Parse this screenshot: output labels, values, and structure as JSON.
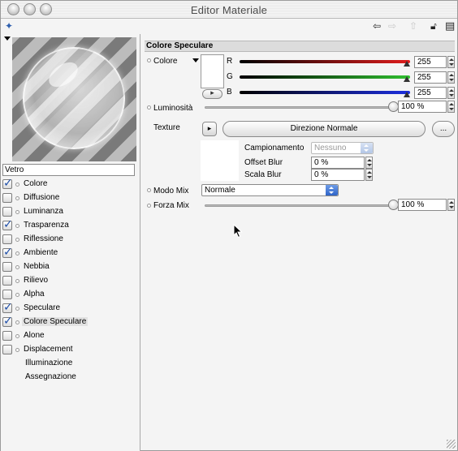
{
  "window": {
    "title": "Editor Materiale"
  },
  "material": {
    "name": "Vetro"
  },
  "channels": [
    {
      "label": "Colore",
      "checked": true,
      "dot": true
    },
    {
      "label": "Diffusione",
      "checked": false,
      "dot": true
    },
    {
      "label": "Luminanza",
      "checked": false,
      "dot": true
    },
    {
      "label": "Trasparenza",
      "checked": true,
      "dot": true
    },
    {
      "label": "Riflessione",
      "checked": false,
      "dot": true
    },
    {
      "label": "Ambiente",
      "checked": true,
      "dot": true
    },
    {
      "label": "Nebbia",
      "checked": false,
      "dot": true
    },
    {
      "label": "Rilievo",
      "checked": false,
      "dot": true
    },
    {
      "label": "Alpha",
      "checked": false,
      "dot": true
    },
    {
      "label": "Speculare",
      "checked": true,
      "dot": true
    },
    {
      "label": "Colore Speculare",
      "checked": true,
      "dot": true,
      "selected": true
    },
    {
      "label": "Alone",
      "checked": false,
      "dot": true
    },
    {
      "label": "Displacement",
      "checked": false,
      "dot": true
    },
    {
      "label": "Illuminazione",
      "checked": null,
      "dot": false
    },
    {
      "label": "Assegnazione",
      "checked": null,
      "dot": false
    }
  ],
  "section": {
    "title": "Colore Speculare"
  },
  "color": {
    "label": "Colore",
    "r_label": "R",
    "g_label": "G",
    "b_label": "B",
    "r_value": "255",
    "g_value": "255",
    "b_value": "255",
    "r_color": "#e01c1c",
    "g_color": "#2fc02f",
    "b_color": "#1c2ee0"
  },
  "brightness": {
    "label": "Luminosità",
    "value": "100 %",
    "level": 1.0
  },
  "texture": {
    "label": "Texture",
    "button_label": "Direzione Normale",
    "more_label": "...",
    "sampling_label": "Campionamento",
    "sampling_value": "Nessuno",
    "offset_blur_label": "Offset Blur",
    "offset_blur_value": "0 %",
    "scale_blur_label": "Scala Blur",
    "scale_blur_value": "0 %"
  },
  "mix": {
    "mode_label": "Modo Mix",
    "mode_value": "Normale",
    "strength_label": "Forza Mix",
    "strength_value": "100 %",
    "strength_level": 1.0
  },
  "icons": {
    "pin": "pin-icon",
    "back": "arrow-left-icon",
    "forward": "arrow-right-icon",
    "up": "arrow-up-icon",
    "lock": "lock-icon",
    "layout": "layout-icon"
  }
}
